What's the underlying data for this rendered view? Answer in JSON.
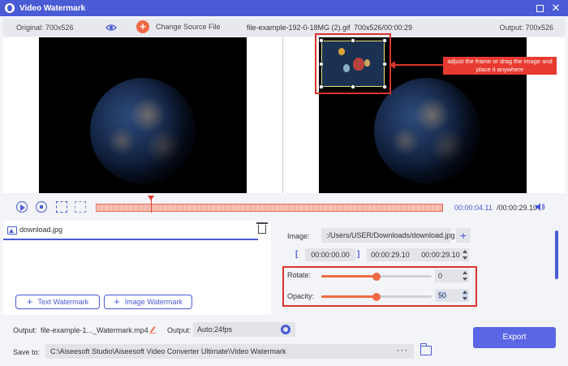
{
  "window": {
    "title": "Video Watermark",
    "maximize_icon": "maximize-icon",
    "close_glyph": "✕"
  },
  "topbar": {
    "original": "Original: 700x526",
    "change_source": "Change Source File",
    "filename": "file-example-192-0-18MG (2).gif",
    "fileinfo": "700x526/00:00:29",
    "output": "Output: 700x526"
  },
  "preview": {
    "hint": "adjust the frame or drag the image and place it anywhere"
  },
  "controls": {
    "current_time": "00:00:04.11",
    "total_time": "/00:00:29.10"
  },
  "watermarks": {
    "item_label": "download.jpg",
    "add_text": "Text Watermark",
    "add_image": "Image Watermark"
  },
  "settings": {
    "image_label": "Image:",
    "image_path": ":/Users/USER/Downloads/download.jpg",
    "start_time": "00:00:00.00",
    "end_time": "00:00:29.10",
    "duration": "00:00:29.10",
    "rotate_label": "Rotate:",
    "rotate_value": "0",
    "rotate_level": 0.5,
    "opacity_label": "Opacity:",
    "opacity_value": "50",
    "opacity_level": 0.5
  },
  "output": {
    "output_label": "Output:",
    "output_file": "file-example-1..._Watermark.mp4",
    "format_label": "Output:",
    "format_value": "Auto;24fps",
    "save_label": "Save to:",
    "save_path": "C:\\Aiseesoft Studio\\Aiseesoft Video Converter Ultimate\\Video Watermark",
    "browse": "···",
    "export": "Export"
  },
  "colors": {
    "accent": "#4a5bd6",
    "orange": "#f06a45",
    "highlight": "#d9342b"
  }
}
